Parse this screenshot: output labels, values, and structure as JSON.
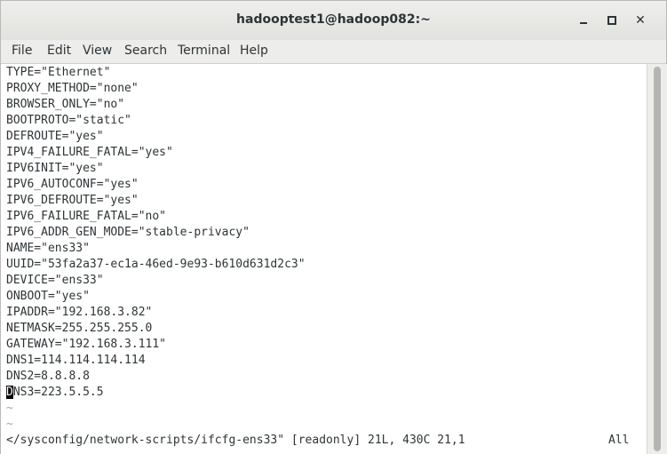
{
  "window": {
    "title": "hadooptest1@hadoop082:~"
  },
  "menu": [
    "File",
    "Edit",
    "View",
    "Search",
    "Terminal",
    "Help"
  ],
  "terminal": {
    "lines": [
      "TYPE=\"Ethernet\"",
      "PROXY_METHOD=\"none\"",
      "BROWSER_ONLY=\"no\"",
      "BOOTPROTO=\"static\"",
      "DEFROUTE=\"yes\"",
      "IPV4_FAILURE_FATAL=\"yes\"",
      "IPV6INIT=\"yes\"",
      "IPV6_AUTOCONF=\"yes\"",
      "IPV6_DEFROUTE=\"yes\"",
      "IPV6_FAILURE_FATAL=\"no\"",
      "IPV6_ADDR_GEN_MODE=\"stable-privacy\"",
      "NAME=\"ens33\"",
      "UUID=\"53fa2a37-ec1a-46ed-9e93-b610d631d2c3\"",
      "DEVICE=\"ens33\"",
      "ONBOOT=\"yes\"",
      "IPADDR=\"192.168.3.82\"",
      "NETMASK=255.255.255.0",
      "GATEWAY=\"192.168.3.111\"",
      "DNS1=114.114.114.114",
      "DNS2=8.8.8.8"
    ],
    "cursor_line": {
      "cursor_char": "D",
      "rest": "NS3=223.5.5.5"
    },
    "tildes": [
      "~",
      "~"
    ],
    "status": "</sysconfig/network-scripts/ifcfg-ens33\" [readonly] 21L, 430C 21,1",
    "status_position": "All"
  }
}
